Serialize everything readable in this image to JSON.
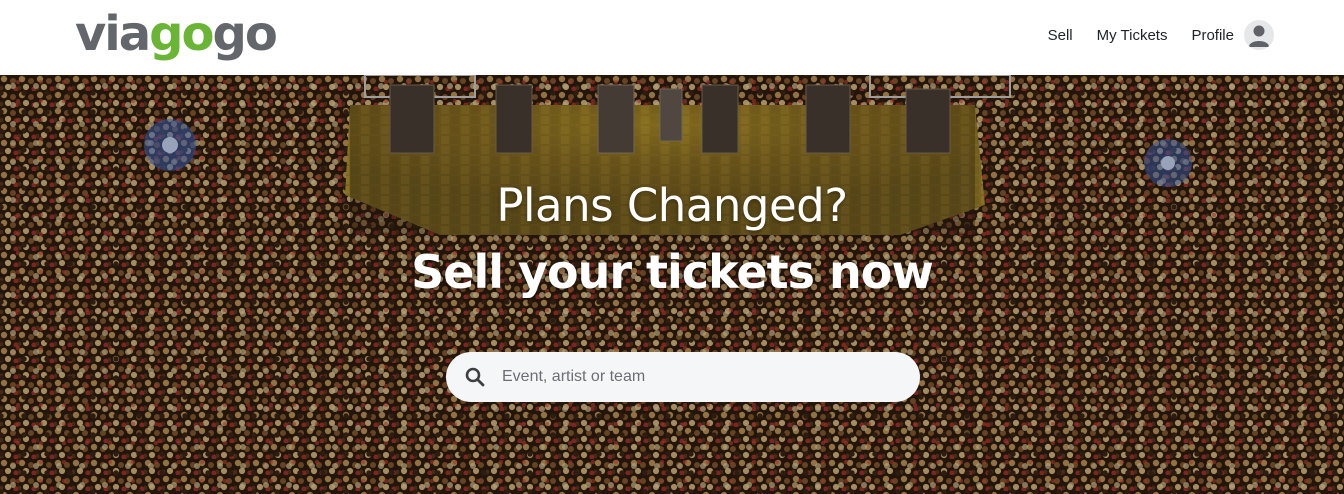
{
  "brand": {
    "logo_part1": "via",
    "logo_part2": "go",
    "logo_part3": "go",
    "logo_gray": "#63666a",
    "logo_green": "#6bb536"
  },
  "nav": {
    "sell_label": "Sell",
    "my_tickets_label": "My Tickets",
    "profile_label": "Profile",
    "profile_icon": "user-avatar-icon"
  },
  "hero": {
    "title": "Plans Changed?",
    "subtitle": "Sell your tickets now",
    "background": "concert-crowd-photo"
  },
  "search": {
    "placeholder": "Event, artist or team",
    "value": "",
    "icon": "search-icon"
  }
}
